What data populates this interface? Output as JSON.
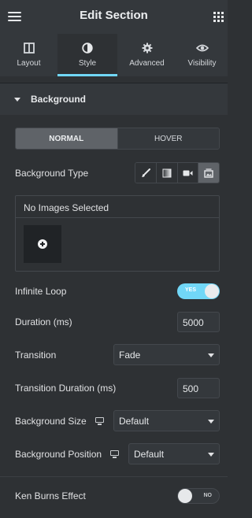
{
  "header": {
    "title": "Edit Section",
    "menu_icon": "hamburger-icon",
    "apps_icon": "grid-icon"
  },
  "tabs": [
    {
      "label": "Layout",
      "icon": "columns-icon",
      "active": false
    },
    {
      "label": "Style",
      "icon": "half-circle-icon",
      "active": true
    },
    {
      "label": "Advanced",
      "icon": "gear-icon",
      "active": false
    },
    {
      "label": "Visibility",
      "icon": "eye-icon",
      "active": false
    }
  ],
  "section": {
    "title": "Background",
    "expanded": true
  },
  "state_tabs": {
    "normal": "NORMAL",
    "hover": "HOVER",
    "selected": "NORMAL"
  },
  "background_type": {
    "label": "Background Type",
    "options": [
      "brush-icon",
      "gradient-icon",
      "video-icon",
      "slideshow-icon"
    ],
    "selected_index": 3
  },
  "gallery": {
    "title": "No Images Selected",
    "add_icon": "plus-circle-icon"
  },
  "infinite_loop": {
    "label": "Infinite Loop",
    "state": "YES",
    "on": true
  },
  "duration": {
    "label": "Duration (ms)",
    "value": "5000"
  },
  "transition": {
    "label": "Transition",
    "value": "Fade"
  },
  "transition_duration": {
    "label": "Transition Duration (ms)",
    "value": "500"
  },
  "background_size": {
    "label": "Background Size",
    "value": "Default",
    "responsive_icon": "desktop-icon"
  },
  "background_position": {
    "label": "Background Position",
    "value": "Default",
    "responsive_icon": "desktop-icon"
  },
  "ken_burns": {
    "label": "Ken Burns Effect",
    "state": "NO",
    "on": false
  },
  "colors": {
    "accent": "#71d7f7",
    "panel": "#2e3134",
    "header": "#34383c",
    "border": "#44484d"
  }
}
